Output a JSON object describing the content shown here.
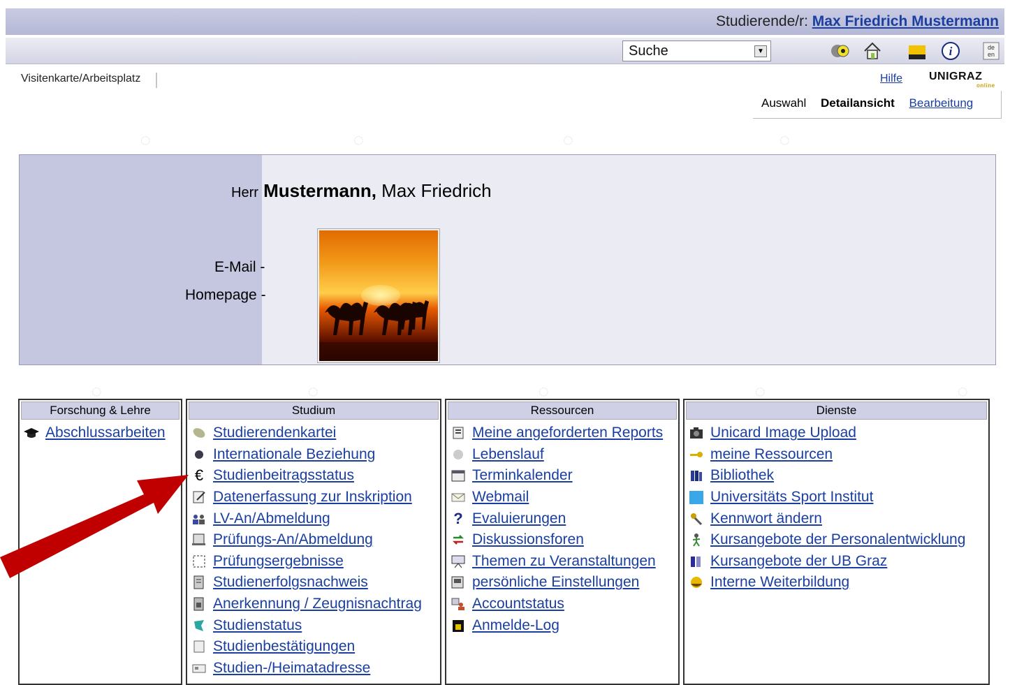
{
  "header": {
    "user_prefix": "Studierende/r:",
    "user_name": "Max Friedrich Mustermann",
    "search_label": "Suche",
    "lang_label_de": "de",
    "lang_label_en": "en"
  },
  "nav": {
    "tab_label": "Visitenkarte/Arbeitsplatz",
    "hilfe": "Hilfe",
    "logo_main": "UNIGRAZ",
    "logo_sub": "online"
  },
  "view_tabs": {
    "auswahl": "Auswahl",
    "detailansicht": "Detailansicht",
    "bearbeitung": "Bearbeitung"
  },
  "card": {
    "salutation": "Herr",
    "last_name": "Mustermann,",
    "first_names": "Max Friedrich",
    "email_label": "E-Mail",
    "email_value": "-",
    "homepage_label": "Homepage",
    "homepage_value": "-"
  },
  "boxes": {
    "forschung": {
      "title": "Forschung & Lehre",
      "items": [
        {
          "label": "Abschlussarbeiten",
          "icon": "graduation-cap-icon"
        }
      ]
    },
    "studium": {
      "title": "Studium",
      "items": [
        {
          "label": "Studierendenkartei",
          "icon": "card-file-icon"
        },
        {
          "label": "Internationale Beziehung",
          "icon": "globe-icon"
        },
        {
          "label": "Studienbeitragsstatus",
          "icon": "euro-icon"
        },
        {
          "label": "Datenerfassung zur Inskription",
          "icon": "edit-form-icon"
        },
        {
          "label": "LV-An/Abmeldung",
          "icon": "people-icon"
        },
        {
          "label": "Prüfungs-An/Abmeldung",
          "icon": "exam-registration-icon"
        },
        {
          "label": "Prüfungsergebnisse",
          "icon": "results-icon"
        },
        {
          "label": "Studienerfolgsnachweis",
          "icon": "certificate-icon"
        },
        {
          "label": "Anerkennung / Zeugnisnachtrag",
          "icon": "recognition-icon"
        },
        {
          "label": "Studienstatus",
          "icon": "status-icon"
        },
        {
          "label": "Studienbestätigungen",
          "icon": "confirmation-icon"
        },
        {
          "label": "Studien-/Heimatadresse",
          "icon": "address-icon"
        }
      ]
    },
    "ressourcen": {
      "title": "Ressourcen",
      "items": [
        {
          "label": "Meine angeforderten Reports",
          "icon": "report-icon"
        },
        {
          "label": "Lebenslauf",
          "icon": "cv-icon"
        },
        {
          "label": "Terminkalender",
          "icon": "calendar-icon"
        },
        {
          "label": "Webmail",
          "icon": "mail-icon"
        },
        {
          "label": "Evaluierungen",
          "icon": "question-icon"
        },
        {
          "label": "Diskussionsforen",
          "icon": "forum-arrows-icon"
        },
        {
          "label": "Themen zu Veranstaltungen",
          "icon": "presentation-icon"
        },
        {
          "label": "persönliche Einstellungen",
          "icon": "settings-icon"
        },
        {
          "label": "Accountstatus",
          "icon": "account-icon"
        },
        {
          "label": "Anmelde-Log",
          "icon": "lock-icon"
        }
      ]
    },
    "dienste": {
      "title": "Dienste",
      "items": [
        {
          "label": "Unicard Image Upload",
          "icon": "camera-icon"
        },
        {
          "label": "meine Ressourcen",
          "icon": "key-icon"
        },
        {
          "label": "Bibliothek",
          "icon": "books-icon"
        },
        {
          "label": "Universitäts Sport Institut",
          "icon": "sport-icon"
        },
        {
          "label": "Kennwort ändern",
          "icon": "password-key-icon"
        },
        {
          "label": "Kursangebote der Personalentwicklung",
          "icon": "person-course-icon"
        },
        {
          "label": "Kursangebote der UB Graz",
          "icon": "library-course-icon"
        },
        {
          "label": "Interne Weiterbildung",
          "icon": "training-icon"
        }
      ]
    }
  },
  "colors": {
    "link": "#1a3fa0",
    "header_bar": "#c9cbe3",
    "card_sidebar": "#c5c6df",
    "arrow": "#c00000"
  }
}
